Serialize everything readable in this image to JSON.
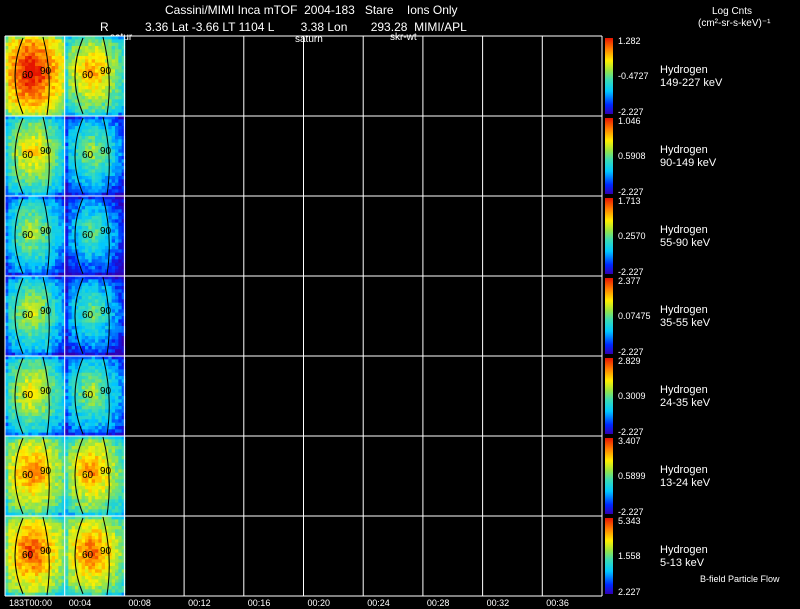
{
  "header": {
    "title": "Cassini/MIMI Inca mTOF  2004-183   Stare    Ions Only",
    "r_label": "R",
    "position_readout": "3.36 Lat -3.66 LT 1104 L        3.38 Lon       293.28  MIMI/APL",
    "units_line1": "Log Cnts",
    "units_line2": "(cm²-sr-s-keV)⁻¹",
    "label_satur": "satur",
    "label_saturn": "saturn",
    "label_skr": "skr-wt"
  },
  "footer": {
    "bfield_label": "B-field Particle Flow"
  },
  "chart_data": {
    "type": "heatmap",
    "x_ticks": [
      "183T00:00",
      "00:04",
      "00:08",
      "00:12",
      "00:16",
      "00:20",
      "00:24",
      "00:28",
      "00:32",
      "00:36"
    ],
    "image_count": 2,
    "contour_labels": [
      "60",
      "90"
    ],
    "grid": true,
    "colormap": "rainbow",
    "bands": [
      {
        "species": "Hydrogen",
        "energy": "149-227 keV",
        "cbar_max": "1.282",
        "cbar_mid": "-0.4727",
        "cbar_min": "-2.227",
        "intensity": [
          0.85,
          0.62
        ]
      },
      {
        "species": "Hydrogen",
        "energy": "90-149 keV",
        "cbar_max": "1.046",
        "cbar_mid": "0.5908",
        "cbar_min": "-2.227",
        "intensity": [
          0.55,
          0.38
        ]
      },
      {
        "species": "Hydrogen",
        "energy": "55-90 keV",
        "cbar_max": "1.713",
        "cbar_mid": "0.2570",
        "cbar_min": "-2.227",
        "intensity": [
          0.42,
          0.3
        ]
      },
      {
        "species": "Hydrogen",
        "energy": "35-55 keV",
        "cbar_max": "2.377",
        "cbar_mid": "0.07475",
        "cbar_min": "-2.227",
        "intensity": [
          0.45,
          0.32
        ]
      },
      {
        "species": "Hydrogen",
        "energy": "24-35 keV",
        "cbar_max": "2.829",
        "cbar_mid": "0.3009",
        "cbar_min": "-2.227",
        "intensity": [
          0.52,
          0.4
        ]
      },
      {
        "species": "Hydrogen",
        "energy": "13-24 keV",
        "cbar_max": "3.407",
        "cbar_mid": "0.5899",
        "cbar_min": "-2.227",
        "intensity": [
          0.68,
          0.64
        ]
      },
      {
        "species": "Hydrogen",
        "energy": "5-13 keV",
        "cbar_max": "5.343",
        "cbar_mid": "1.558",
        "cbar_min": "2.227",
        "intensity": [
          0.74,
          0.7
        ]
      }
    ]
  }
}
